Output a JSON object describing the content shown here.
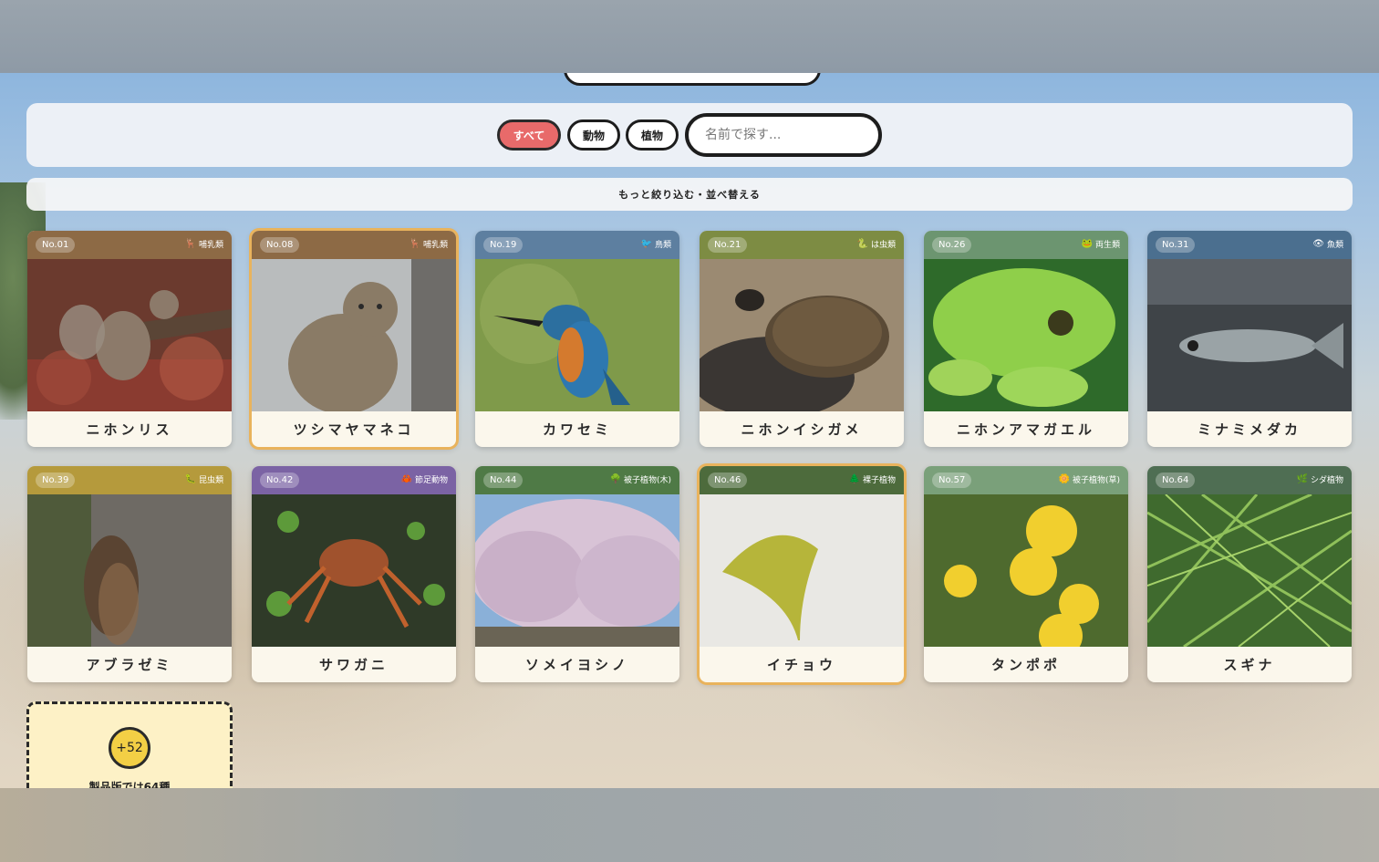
{
  "filters": {
    "all_label": "すべて",
    "animal_label": "動物",
    "plant_label": "植物",
    "search_placeholder": "名前で探す..."
  },
  "more_filters_label": "もっと絞り込む・並べ替える",
  "colors": {
    "mammal": "#8d6a45",
    "bird": "#5d7fa0",
    "reptile": "#7d8c43",
    "amphibian": "#6c9570",
    "fish": "#4b6f8f",
    "insect": "#b59a3c",
    "arthropod": "#7b63a4",
    "tree": "#4f7a46",
    "ginkgo": "#4d6b3c",
    "flower": "#7aa07a",
    "fern": "#4f6e53",
    "active_chip": "#e86a6a"
  },
  "cards": [
    {
      "no": "No.01",
      "category": "哺乳類",
      "icon": "deer-icon",
      "name": "ニホンリス"
    },
    {
      "no": "No.08",
      "category": "哺乳類",
      "icon": "deer-icon",
      "name": "ツシマヤマネコ"
    },
    {
      "no": "No.19",
      "category": "鳥類",
      "icon": "bird-icon",
      "name": "カワセミ"
    },
    {
      "no": "No.21",
      "category": "は虫類",
      "icon": "snake-icon",
      "name": "ニホンイシガメ"
    },
    {
      "no": "No.26",
      "category": "両生類",
      "icon": "frog-icon",
      "name": "ニホンアマガエル"
    },
    {
      "no": "No.31",
      "category": "魚類",
      "icon": "fish-icon",
      "name": "ミナミメダカ"
    },
    {
      "no": "No.39",
      "category": "昆虫類",
      "icon": "bug-icon",
      "name": "アブラゼミ"
    },
    {
      "no": "No.42",
      "category": "節足動物",
      "icon": "crab-icon",
      "name": "サワガニ"
    },
    {
      "no": "No.44",
      "category": "被子植物(木)",
      "icon": "tree-icon",
      "name": "ソメイヨシノ"
    },
    {
      "no": "No.46",
      "category": "裸子植物",
      "icon": "conifer-icon",
      "name": "イチョウ"
    },
    {
      "no": "No.57",
      "category": "被子植物(草)",
      "icon": "flower-icon",
      "name": "タンポポ"
    },
    {
      "no": "No.64",
      "category": "シダ植物",
      "icon": "fern-icon",
      "name": "スギナ"
    }
  ],
  "more": {
    "count": "+52",
    "text": "製品版では64種"
  }
}
